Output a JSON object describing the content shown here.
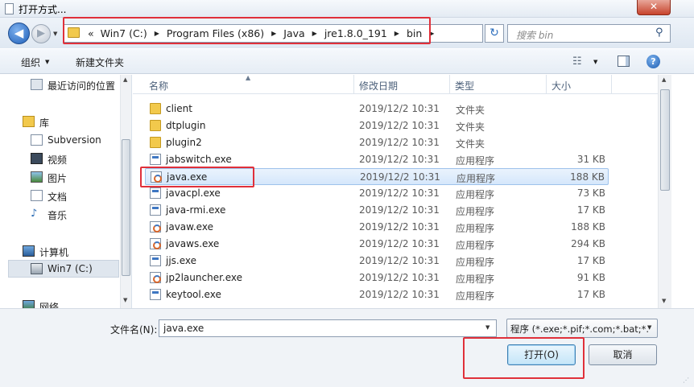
{
  "window": {
    "title": "打开方式...",
    "close_glyph": "✕"
  },
  "nav": {
    "back_glyph": "◀",
    "forward_glyph": "▶",
    "breadcrumb_prefix": "«",
    "breadcrumbs": [
      "Win7 (C:)",
      "Program Files (x86)",
      "Java",
      "jre1.8.0_191",
      "bin"
    ],
    "search_placeholder": "搜索 bin",
    "refresh_glyph": "↻"
  },
  "toolbar": {
    "organize": "组织",
    "new_folder": "新建文件夹",
    "help_glyph": "?"
  },
  "sidebar": {
    "items": [
      {
        "label": "最近访问的位置",
        "icon": "recent-places-icon"
      },
      {
        "label": "库",
        "icon": "library-icon"
      },
      {
        "label": "Subversion",
        "icon": "subversion-icon"
      },
      {
        "label": "视频",
        "icon": "video-icon"
      },
      {
        "label": "图片",
        "icon": "picture-icon"
      },
      {
        "label": "文档",
        "icon": "document-icon"
      },
      {
        "label": "音乐",
        "icon": "music-icon"
      },
      {
        "label": "计算机",
        "icon": "computer-icon"
      },
      {
        "label": "Win7 (C:)",
        "icon": "drive-icon",
        "selected": true
      },
      {
        "label": "网络",
        "icon": "network-icon"
      }
    ]
  },
  "columns": {
    "name": "名称",
    "date": "修改日期",
    "type": "类型",
    "size": "大小"
  },
  "files": [
    {
      "name": "client",
      "date": "2019/12/2 10:31",
      "type": "文件夹",
      "size": "",
      "icon": "folder-icon"
    },
    {
      "name": "dtplugin",
      "date": "2019/12/2 10:31",
      "type": "文件夹",
      "size": "",
      "icon": "folder-icon"
    },
    {
      "name": "plugin2",
      "date": "2019/12/2 10:31",
      "type": "文件夹",
      "size": "",
      "icon": "folder-icon"
    },
    {
      "name": "jabswitch.exe",
      "date": "2019/12/2 10:31",
      "type": "应用程序",
      "size": "31 KB",
      "icon": "exe-icon"
    },
    {
      "name": "java.exe",
      "date": "2019/12/2 10:31",
      "type": "应用程序",
      "size": "188 KB",
      "icon": "java-icon",
      "selected": true
    },
    {
      "name": "javacpl.exe",
      "date": "2019/12/2 10:31",
      "type": "应用程序",
      "size": "73 KB",
      "icon": "exe-icon"
    },
    {
      "name": "java-rmi.exe",
      "date": "2019/12/2 10:31",
      "type": "应用程序",
      "size": "17 KB",
      "icon": "exe-icon"
    },
    {
      "name": "javaw.exe",
      "date": "2019/12/2 10:31",
      "type": "应用程序",
      "size": "188 KB",
      "icon": "java-icon"
    },
    {
      "name": "javaws.exe",
      "date": "2019/12/2 10:31",
      "type": "应用程序",
      "size": "294 KB",
      "icon": "java-icon"
    },
    {
      "name": "jjs.exe",
      "date": "2019/12/2 10:31",
      "type": "应用程序",
      "size": "17 KB",
      "icon": "exe-icon"
    },
    {
      "name": "jp2launcher.exe",
      "date": "2019/12/2 10:31",
      "type": "应用程序",
      "size": "91 KB",
      "icon": "java-icon"
    },
    {
      "name": "keytool.exe",
      "date": "2019/12/2 10:31",
      "type": "应用程序",
      "size": "17 KB",
      "icon": "exe-icon"
    }
  ],
  "bottom": {
    "filename_label": "文件名(N):",
    "filename_value": "java.exe",
    "filter": "程序 (*.exe;*.pif;*.com;*.bat;*.",
    "open_button": "打开(O)",
    "cancel_button": "取消"
  },
  "colors": {
    "annotation_red": "#e0303a",
    "selection_blue": "#d5e7fb"
  }
}
